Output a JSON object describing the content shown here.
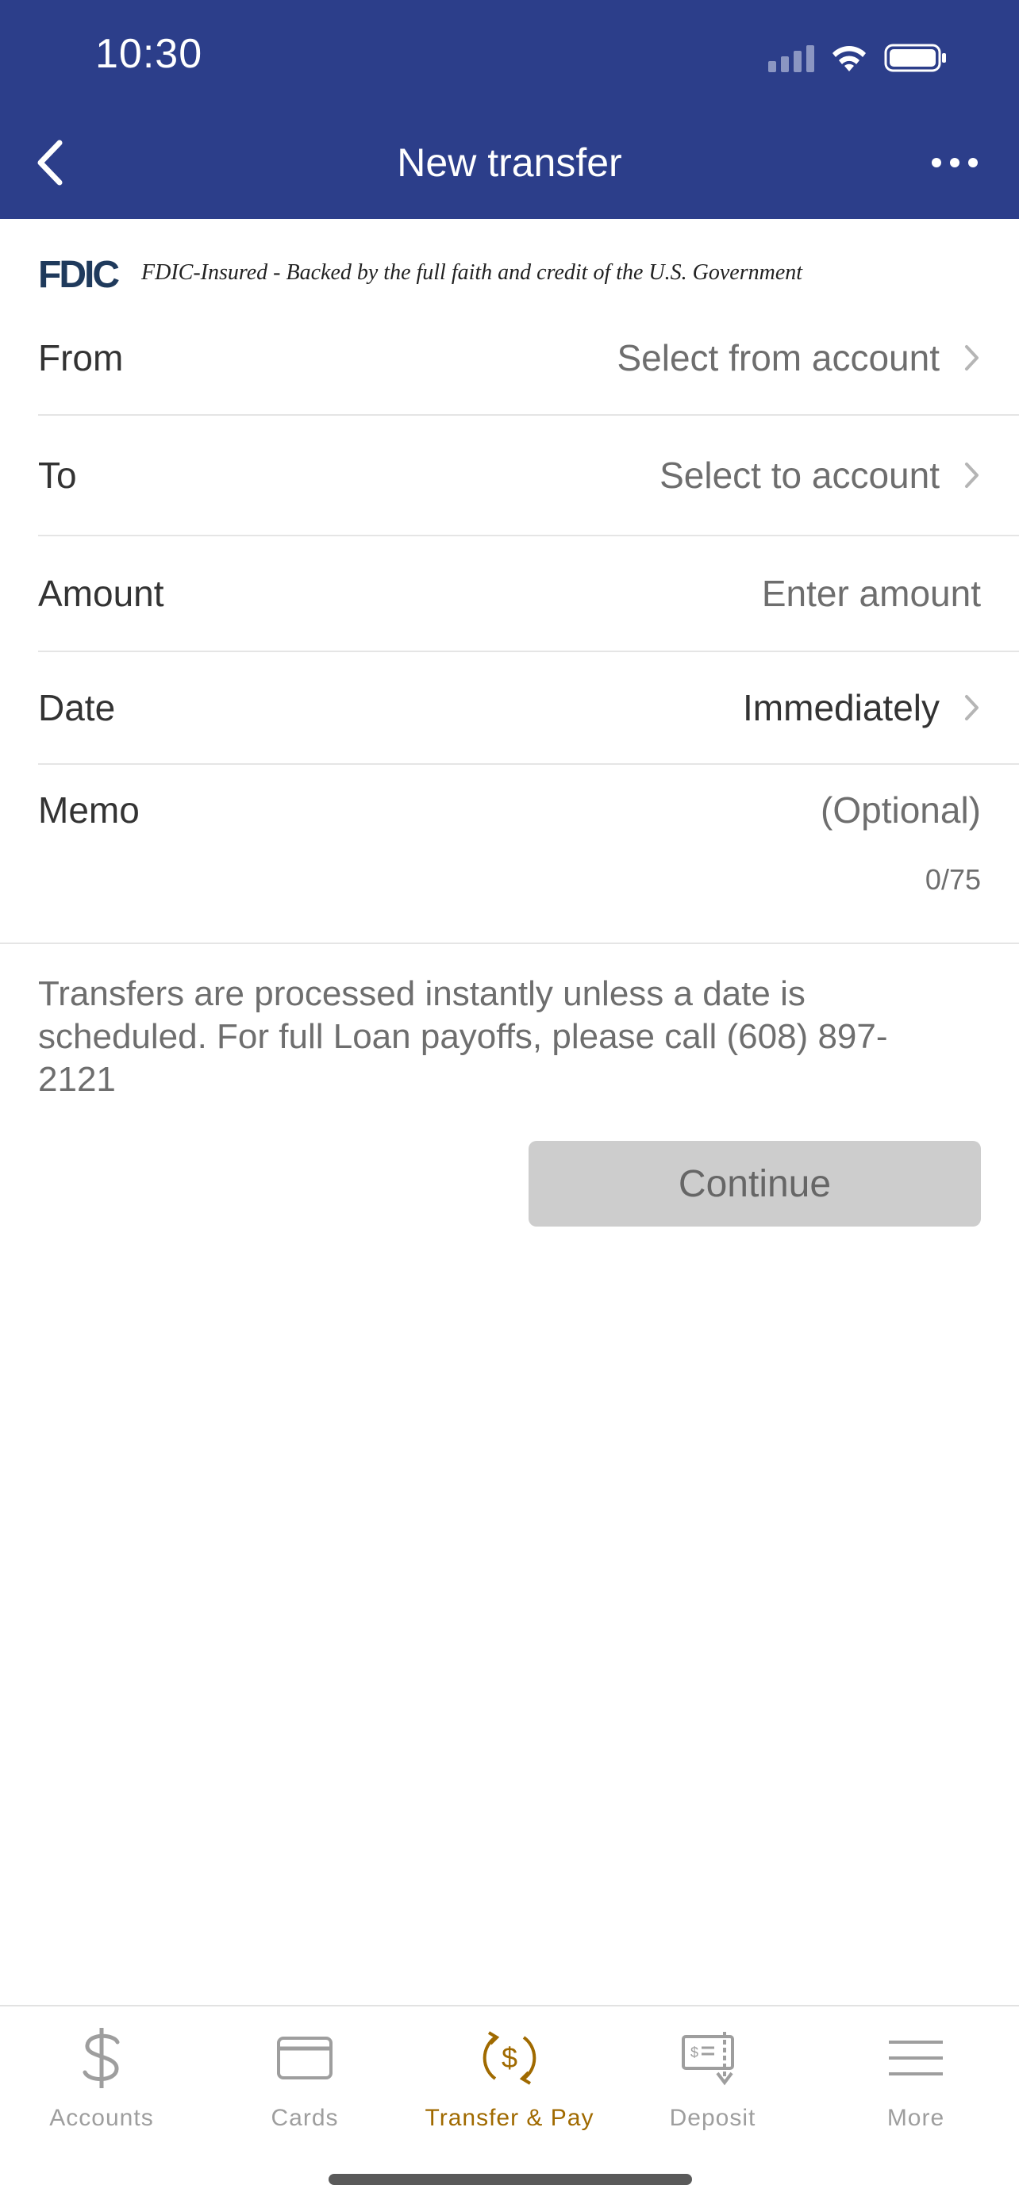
{
  "status_bar": {
    "time": "10:30"
  },
  "header": {
    "title": "New transfer"
  },
  "fdic": {
    "logo_text": "FDIC",
    "tagline": "FDIC-Insured - Backed by the full faith and credit of the U.S. Government"
  },
  "form": {
    "from": {
      "label": "From",
      "value": "Select from account"
    },
    "to": {
      "label": "To",
      "value": "Select to account"
    },
    "amount": {
      "label": "Amount",
      "placeholder": "Enter amount"
    },
    "date": {
      "label": "Date",
      "value": "Immediately"
    },
    "memo": {
      "label": "Memo",
      "placeholder": "(Optional)",
      "counter": "0/75"
    }
  },
  "info_text": "Transfers are processed instantly unless a date is scheduled. For full Loan payoffs, please call (608) 897-2121",
  "continue_label": "Continue",
  "tabs": [
    {
      "label": "Accounts",
      "icon": "dollar-icon"
    },
    {
      "label": "Cards",
      "icon": "card-icon"
    },
    {
      "label": "Transfer & Pay",
      "icon": "transfer-icon",
      "active": true
    },
    {
      "label": "Deposit",
      "icon": "check-deposit-icon"
    },
    {
      "label": "More",
      "icon": "menu-icon"
    }
  ],
  "colors": {
    "header_bg": "#2C3E8A",
    "active_tab": "#A06A00",
    "button_disabled": "#CDCDCD"
  }
}
